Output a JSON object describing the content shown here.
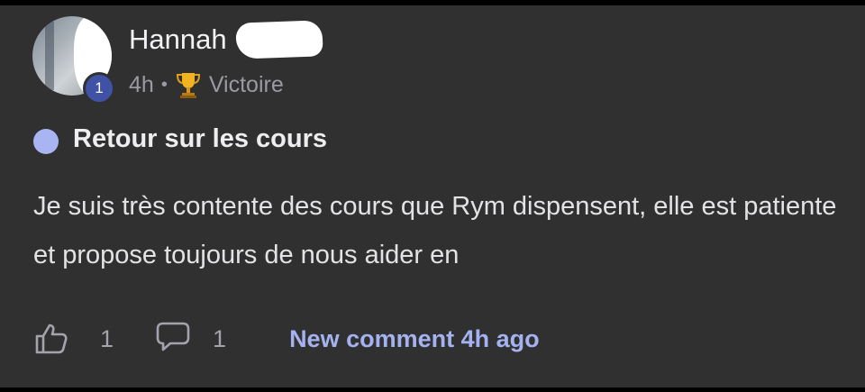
{
  "post": {
    "author": {
      "name": "Hannah",
      "level": "1",
      "time_ago": "4h",
      "separator": "•",
      "badge_label": "Victoire",
      "badge_icon": "trophy-icon"
    },
    "category_color": "#a9b5f2",
    "title": "Retour sur les cours",
    "body": "Je suis très contente des cours que Rym dispensent, elle est patiente et propose toujours de nous aider en",
    "actions": {
      "like_icon": "thumbs-up-icon",
      "like_count": "1",
      "comment_icon": "speech-bubble-icon",
      "comment_count": "1",
      "new_comment_label": "New comment 4h ago"
    }
  },
  "colors": {
    "card_background": "#313031",
    "level_badge": "#3f52a6",
    "link_accent": "#a4b3f0"
  }
}
